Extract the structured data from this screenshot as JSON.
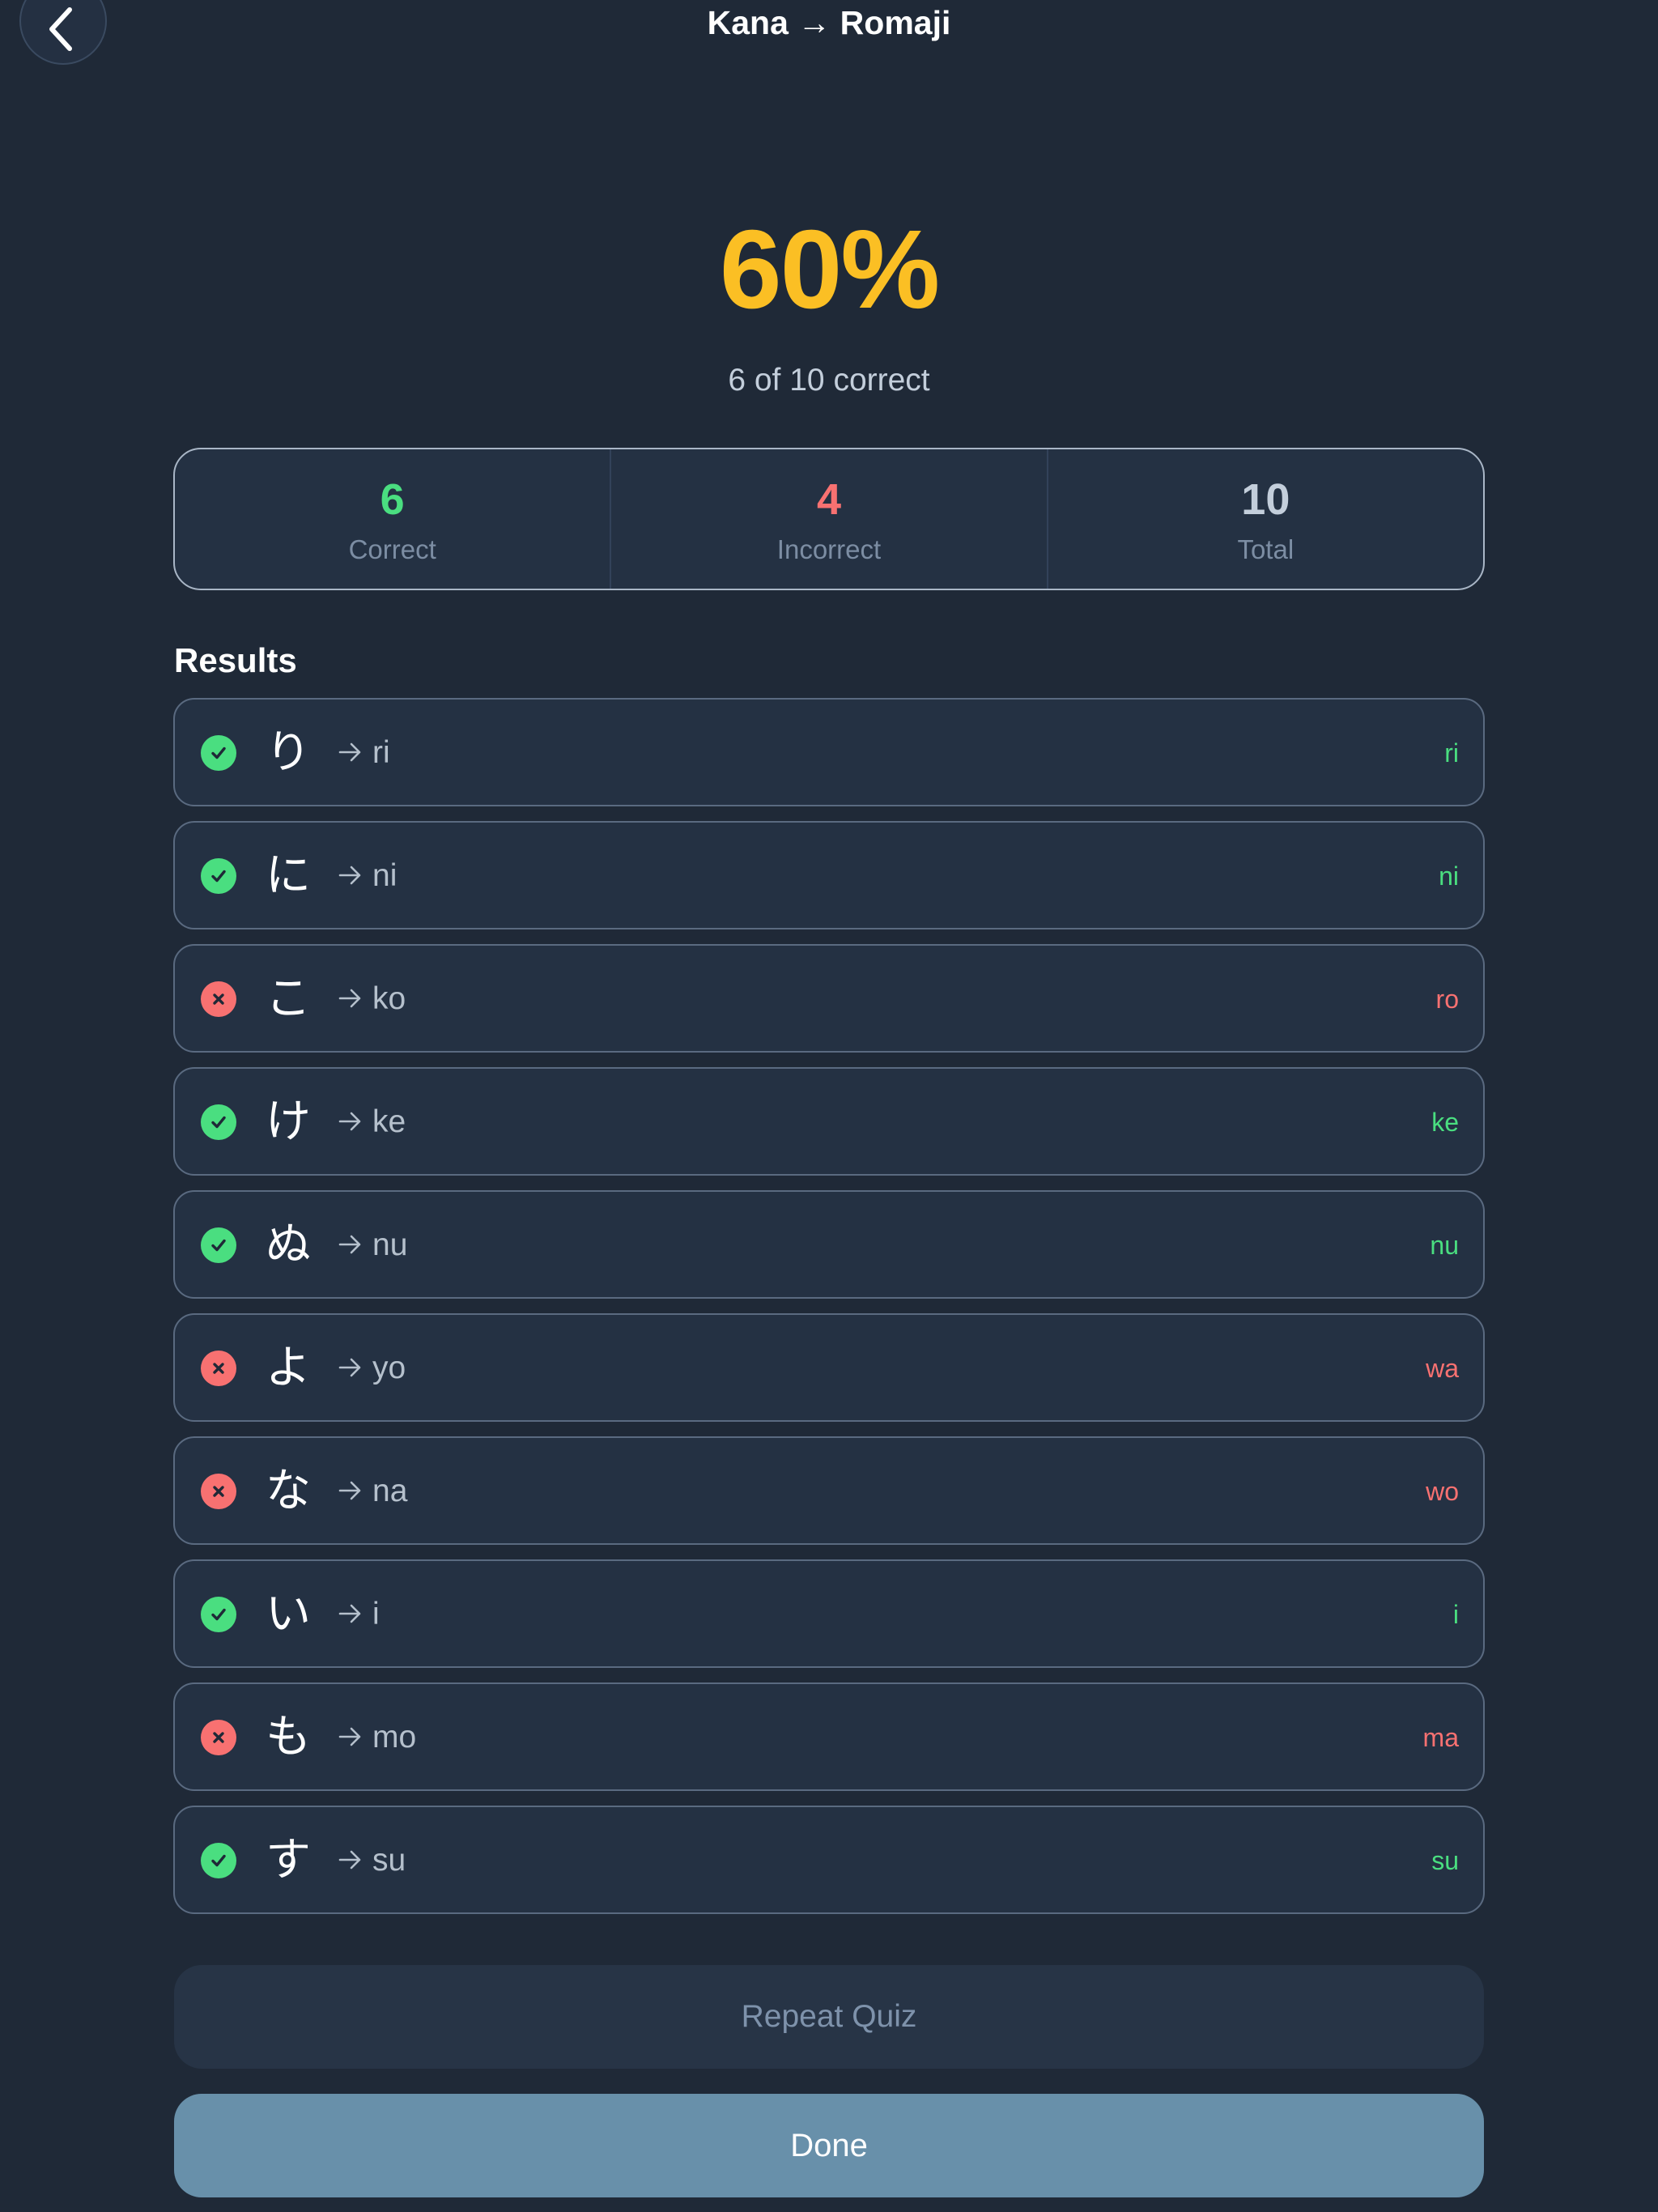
{
  "header": {
    "title": "Kana → Romaji",
    "back_icon": "chevron-left-icon"
  },
  "score": {
    "percent": "60%",
    "summary": "6 of 10 correct",
    "color": "#fbbf24"
  },
  "stats": [
    {
      "value": "6",
      "label": "Correct",
      "color": "#4ade80"
    },
    {
      "value": "4",
      "label": "Incorrect",
      "color": "#f87171"
    },
    {
      "value": "10",
      "label": "Total",
      "color": "#c3cedb"
    }
  ],
  "results": {
    "heading": "Results",
    "items": [
      {
        "kana": "り",
        "romaji": "ri",
        "answer": "ri",
        "correct": true
      },
      {
        "kana": "に",
        "romaji": "ni",
        "answer": "ni",
        "correct": true
      },
      {
        "kana": "こ",
        "romaji": "ko",
        "answer": "ro",
        "correct": false
      },
      {
        "kana": "け",
        "romaji": "ke",
        "answer": "ke",
        "correct": true
      },
      {
        "kana": "ぬ",
        "romaji": "nu",
        "answer": "nu",
        "correct": true
      },
      {
        "kana": "よ",
        "romaji": "yo",
        "answer": "wa",
        "correct": false
      },
      {
        "kana": "な",
        "romaji": "na",
        "answer": "wo",
        "correct": false
      },
      {
        "kana": "い",
        "romaji": "i",
        "answer": "i",
        "correct": true
      },
      {
        "kana": "も",
        "romaji": "mo",
        "answer": "ma",
        "correct": false
      },
      {
        "kana": "す",
        "romaji": "su",
        "answer": "su",
        "correct": true
      }
    ]
  },
  "actions": {
    "repeat_label": "Repeat Quiz",
    "done_label": "Done"
  },
  "colors": {
    "background": "#1f2937",
    "correct": "#4ade80",
    "incorrect": "#f87171",
    "primary_button": "#6890aa"
  }
}
